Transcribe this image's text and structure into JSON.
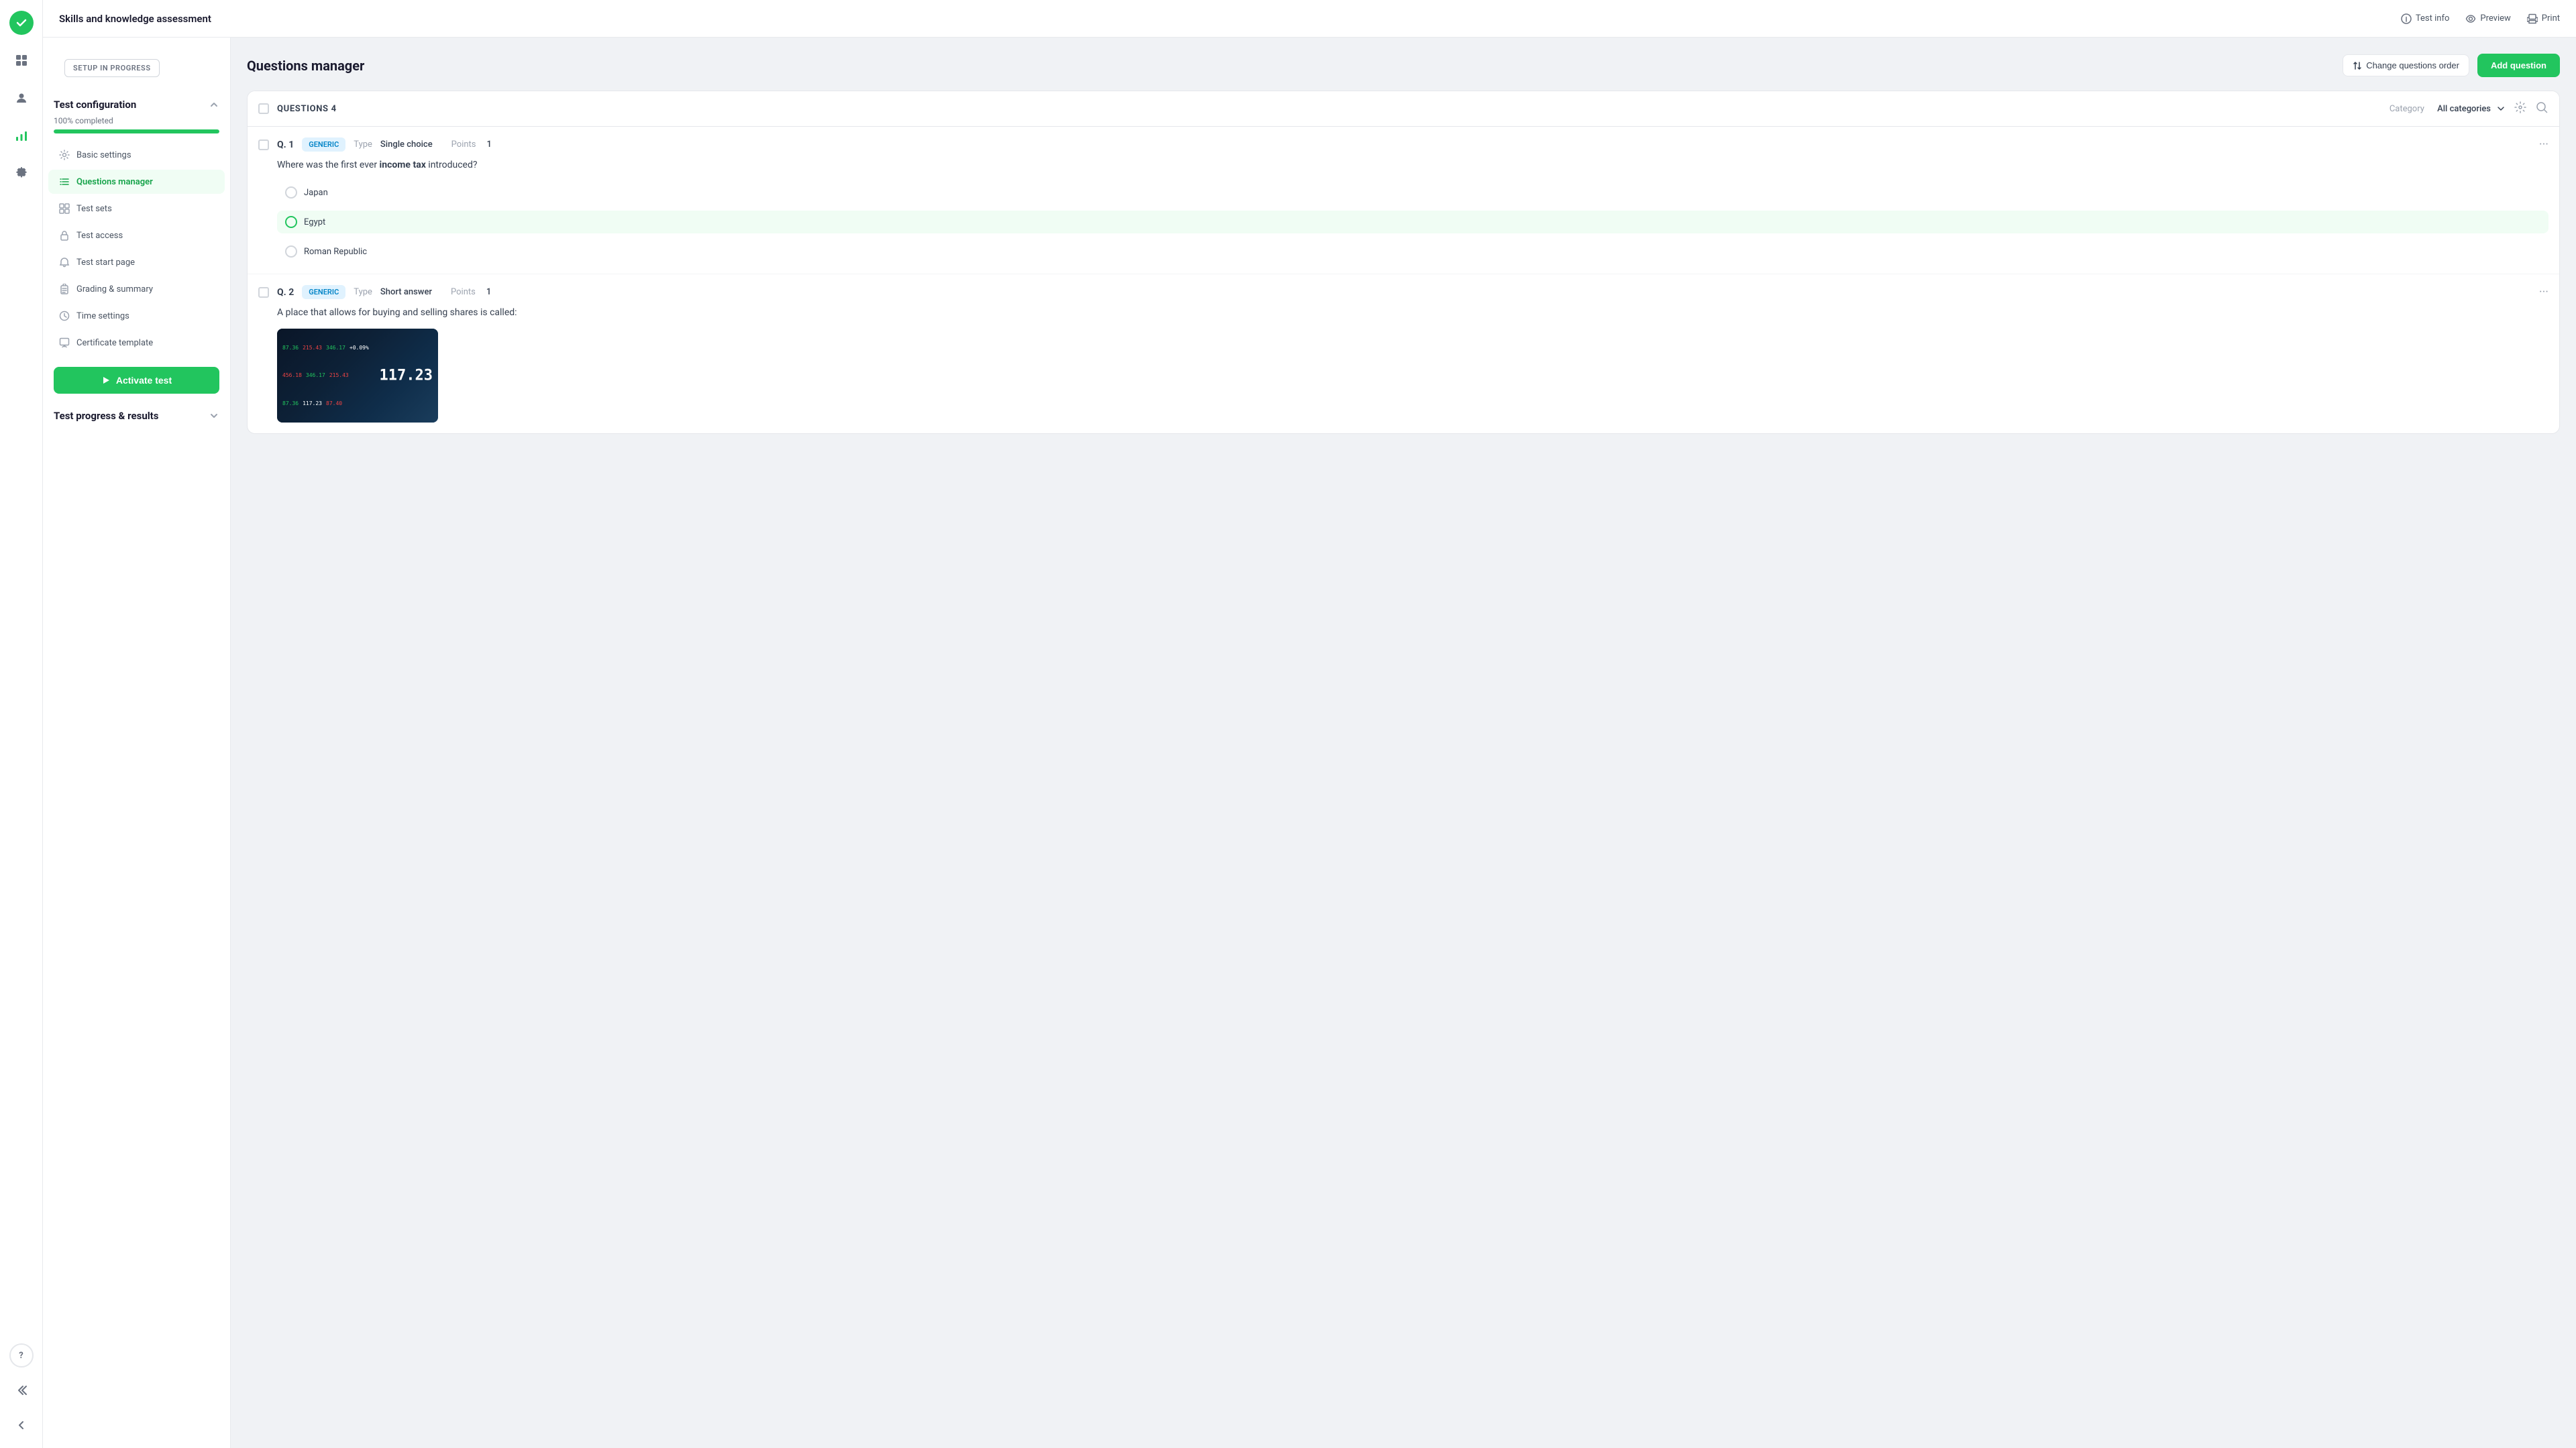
{
  "app": {
    "title": "Skills and knowledge assessment"
  },
  "header": {
    "title": "Skills and knowledge assessment",
    "actions": [
      {
        "id": "test-info",
        "label": "Test info",
        "icon": "info-circle"
      },
      {
        "id": "preview",
        "label": "Preview",
        "icon": "eye"
      },
      {
        "id": "print",
        "label": "Print",
        "icon": "printer"
      }
    ]
  },
  "sidebar": {
    "setup_badge": "SETUP IN PROGRESS",
    "section_title": "Test configuration",
    "progress_label": "100% completed",
    "progress_value": 100,
    "nav_items": [
      {
        "id": "basic-settings",
        "label": "Basic settings",
        "icon": "gear",
        "active": false
      },
      {
        "id": "questions-manager",
        "label": "Questions manager",
        "icon": "list-ordered",
        "active": true
      },
      {
        "id": "test-sets",
        "label": "Test sets",
        "icon": "grid",
        "active": false
      },
      {
        "id": "test-access",
        "label": "Test access",
        "icon": "lock",
        "active": false
      },
      {
        "id": "test-start-page",
        "label": "Test start page",
        "icon": "bell",
        "active": false
      },
      {
        "id": "grading-summary",
        "label": "Grading & summary",
        "icon": "clipboard",
        "active": false
      },
      {
        "id": "time-settings",
        "label": "Time settings",
        "icon": "clock",
        "active": false
      },
      {
        "id": "certificate-template",
        "label": "Certificate template",
        "icon": "certificate",
        "active": false
      }
    ],
    "activate_btn": "Activate test",
    "results_section": "Test progress & results"
  },
  "questions_manager": {
    "title": "Questions manager",
    "change_order_label": "Change questions order",
    "add_question_label": "Add question",
    "questions_count_label": "QUESTIONS 4",
    "category_label": "Category",
    "category_value": "All categories",
    "questions": [
      {
        "id": "q1",
        "number": "Q. 1",
        "badge": "GENERIC",
        "type_label": "Type",
        "type_value": "Single choice",
        "points_label": "Points",
        "points_value": "1",
        "question_text": "Where was the first ever income tax introduced?",
        "question_text_bold": "income tax",
        "options": [
          {
            "id": "opt1",
            "text": "Japan",
            "selected": false,
            "highlighted": false
          },
          {
            "id": "opt2",
            "text": "Egypt",
            "selected": false,
            "highlighted": true
          },
          {
            "id": "opt3",
            "text": "Roman Republic",
            "selected": false,
            "highlighted": false
          }
        ]
      },
      {
        "id": "q2",
        "number": "Q. 2",
        "badge": "GENERIC",
        "type_label": "Type",
        "type_value": "Short answer",
        "points_label": "Points",
        "points_value": "1",
        "question_text": "A place that allows for buying and selling shares is called:",
        "has_image": true
      }
    ]
  },
  "icon_sidebar": {
    "nav_icons": [
      {
        "id": "dashboard",
        "symbol": "⊞"
      },
      {
        "id": "users",
        "symbol": "👤"
      },
      {
        "id": "analytics",
        "symbol": "📊"
      },
      {
        "id": "settings",
        "symbol": "⚙"
      }
    ],
    "bottom_icons": [
      {
        "id": "help",
        "symbol": "?"
      },
      {
        "id": "back",
        "symbol": "↩"
      },
      {
        "id": "collapse",
        "symbol": "«"
      }
    ]
  }
}
